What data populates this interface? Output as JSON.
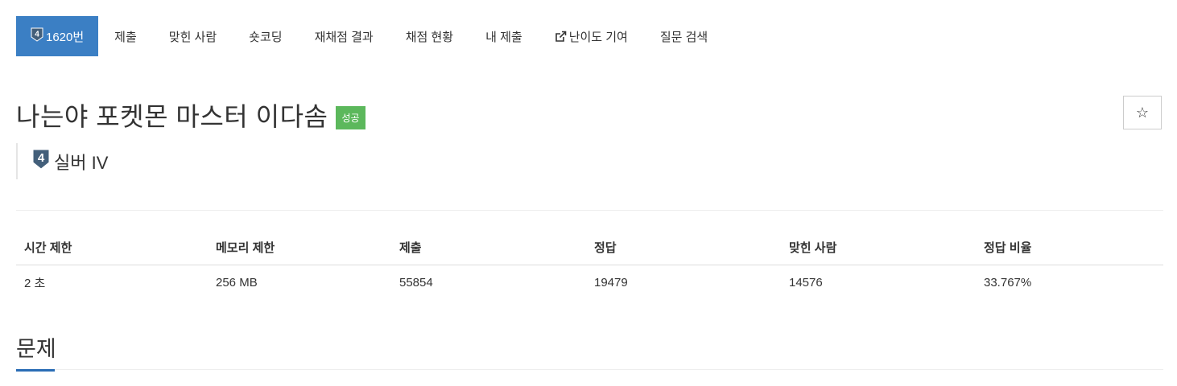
{
  "tabs": [
    {
      "label": "1620번",
      "active": true,
      "icon": "tier-silver-4-badge"
    },
    {
      "label": "제출"
    },
    {
      "label": "맞힌 사람"
    },
    {
      "label": "숏코딩"
    },
    {
      "label": "재채점 결과"
    },
    {
      "label": "채점 현황"
    },
    {
      "label": "내 제출"
    },
    {
      "label": "난이도 기여",
      "icon": "external-link-icon"
    },
    {
      "label": "질문 검색"
    }
  ],
  "problem": {
    "title": "나는야 포켓몬 마스터 이다솜",
    "result_badge": "성공",
    "tier_label": "실버 IV",
    "tier_number": "4",
    "star_icon": "☆"
  },
  "colors": {
    "active_tab": "#3b7fc4",
    "success_badge": "#5cb85c",
    "silver_badge": "#435f7a",
    "section_accent": "#2a6db5"
  },
  "info_table": {
    "headers": [
      "시간 제한",
      "메모리 제한",
      "제출",
      "정답",
      "맞힌 사람",
      "정답 비율"
    ],
    "row": [
      "2 초",
      "256 MB",
      "55854",
      "19479",
      "14576",
      "33.767%"
    ]
  },
  "section": {
    "title": "문제"
  }
}
